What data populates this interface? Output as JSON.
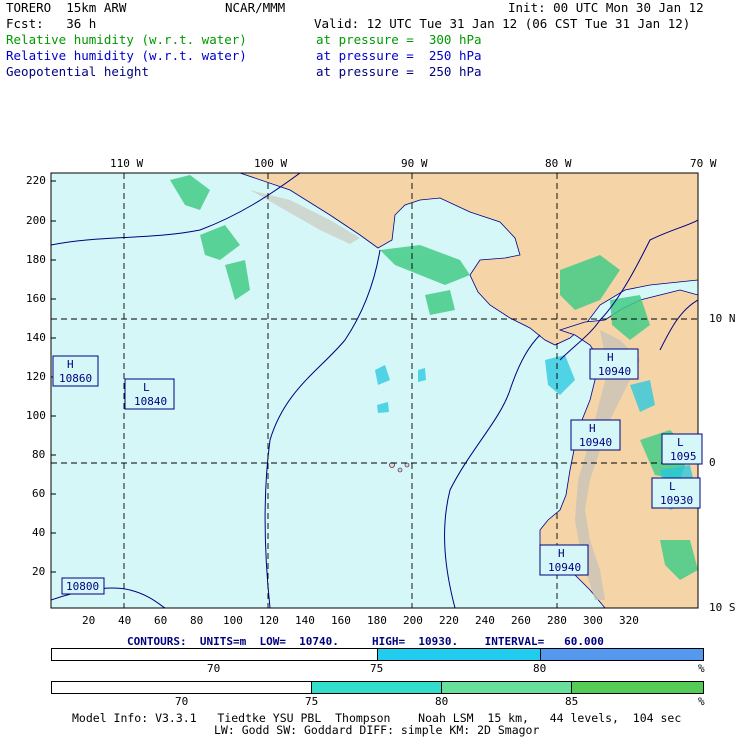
{
  "header": {
    "model": "TORERO  15km ARW",
    "org": "NCAR/MMM",
    "init": "Init: 00 UTC Mon 30 Jan 12",
    "fcst": "Fcst:   36 h",
    "valid": "Valid: 12 UTC Tue 31 Jan 12 (06 CST Tue 31 Jan 12)"
  },
  "fields": [
    {
      "name": "Relative humidity (w.r.t. water)",
      "level": "at pressure =  300 hPa",
      "color": "#009900"
    },
    {
      "name": "Relative humidity (w.r.t. water)",
      "level": "at pressure =  250 hPa",
      "color": "#0000cc"
    },
    {
      "name": "Geopotential height",
      "level": "at pressure =  250 hPa",
      "color": "#000080"
    }
  ],
  "axes": {
    "top_lon": [
      "110 W",
      "100 W",
      "90 W",
      "80 W",
      "70 W"
    ],
    "right_lat": [
      "10 N",
      "0",
      "10 S"
    ],
    "left_y": [
      "220",
      "200",
      "180",
      "160",
      "140",
      "120",
      "100",
      "80",
      "60",
      "40",
      "20"
    ],
    "bottom_x": [
      "20",
      "40",
      "60",
      "80",
      "100",
      "120",
      "140",
      "160",
      "180",
      "200",
      "220",
      "240",
      "260",
      "280",
      "300",
      "320"
    ]
  },
  "labels": [
    {
      "type": "H",
      "value": "10860"
    },
    {
      "type": "L",
      "value": "10840"
    },
    {
      "type": "H",
      "value": "10940"
    },
    {
      "type": "H",
      "value": "10940"
    },
    {
      "type": "L",
      "value": "1095"
    },
    {
      "type": "L",
      "value": "10930"
    },
    {
      "type": "H",
      "value": "10940"
    },
    {
      "type": "",
      "value": "10800"
    }
  ],
  "contours_info": "CONTOURS:  UNITS=m  LOW=  10740.     HIGH=  10930.    INTERVAL=   60.000",
  "colorbar_250": {
    "ticks": [
      "70",
      "75",
      "80"
    ],
    "unit": "%",
    "colors": [
      "#ffffff",
      "#22ccee",
      "#5599ee"
    ]
  },
  "colorbar_300": {
    "ticks": [
      "70",
      "75",
      "80",
      "85"
    ],
    "unit": "%",
    "colors": [
      "#ffffff",
      "#33ddcc",
      "#66e09a",
      "#55cc55"
    ]
  },
  "footer": {
    "line1": "Model Info: V3.3.1   Tiedtke YSU PBL  Thompson    Noah LSM  15 km,   44 levels,  104 sec",
    "line2": "LW: Godd SW: Goddard DIFF: simple KM: 2D Smagor"
  },
  "colors": {
    "ocean": "#d6f7f7",
    "land": "#f5d5a8",
    "rh300": "#44cc88",
    "rh250": "#22c8e0",
    "height": "#000080"
  }
}
